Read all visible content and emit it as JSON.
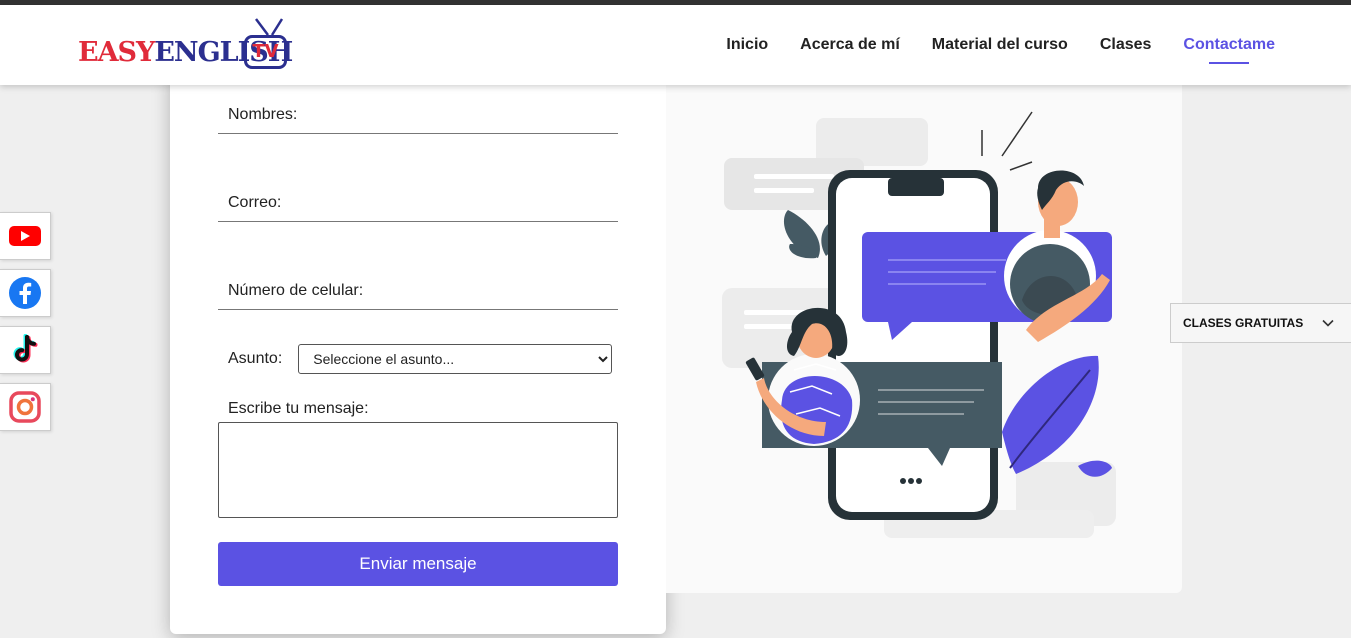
{
  "brand": {
    "easy": "EASY",
    "english": "ENGLISH",
    "tv": "TV"
  },
  "nav": {
    "items": [
      {
        "label": "Inicio"
      },
      {
        "label": "Acerca de mí"
      },
      {
        "label": "Material del curso"
      },
      {
        "label": "Clases"
      },
      {
        "label": "Contactame"
      }
    ],
    "active": "Contactame"
  },
  "form": {
    "nombres_label": "Nombres:",
    "correo_label": "Correo:",
    "celular_label": "Número de celular:",
    "asunto_label": "Asunto:",
    "asunto_selected": "Seleccione el asunto...",
    "mensaje_label": "Escribe tu mensaje:",
    "submit_label": "Enviar mensaje"
  },
  "social": [
    "youtube-icon",
    "facebook-icon",
    "tiktok-icon",
    "instagram-icon"
  ],
  "side_dropdown": {
    "label": "CLASES GRATUITAS"
  },
  "colors": {
    "accent": "#5b52e3",
    "brand_red": "#e02b3a",
    "brand_blue": "#2b2f8f",
    "dark_slate": "#455a64"
  }
}
